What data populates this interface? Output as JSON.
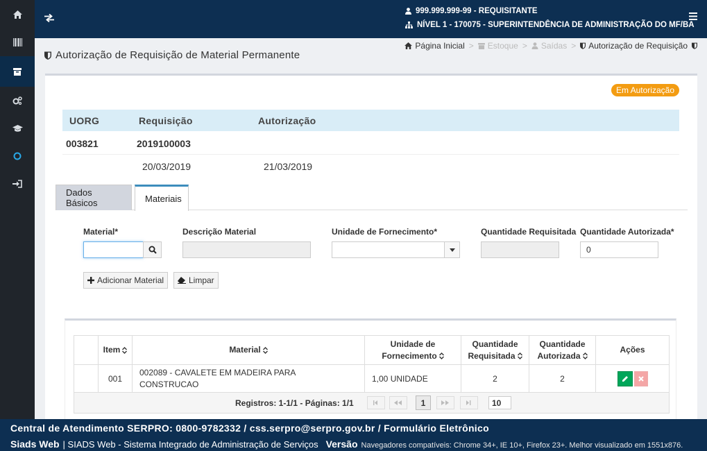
{
  "header": {
    "user": "999.999.999-99 - REQUISITANTE",
    "org": "NÍVEL 1 - 170075 - SUPERINTENDÊNCIA DE ADMINISTRAÇÃO DO MF/BA"
  },
  "page": {
    "title": "Autorização de Requisição de Material Permanente"
  },
  "breadcrumb": {
    "home": "Página Inicial",
    "stock": "Estoque",
    "outputs": "Saídas",
    "current": "Autorização de Requisição",
    "sep": ">"
  },
  "status": "Em Autorização",
  "info": {
    "headers": {
      "uorg": "UORG",
      "requisition": "Requisição",
      "authorization": "Autorização"
    },
    "uorg": "003821",
    "requisition": "2019100003",
    "requisition_date": "20/03/2019",
    "authorization_date": "21/03/2019"
  },
  "tabs": {
    "basic": "Dados Básicos",
    "materials": "Materiais"
  },
  "form": {
    "material_label": "Material*",
    "description_label": "Descrição Material",
    "unit_label": "Unidade de Fornecimento*",
    "qty_requested_label": "Quantidade Requisitada",
    "qty_authorized_label": "Quantidade Autorizada*",
    "qty_authorized_value": "0",
    "add_button": "Adicionar Material",
    "clear_button": "Limpar"
  },
  "table": {
    "headers": {
      "item": "Item",
      "material": "Material",
      "unit_l1": "Unidade de",
      "unit_l2": "Fornecimento",
      "req_l1": "Quantidade",
      "req_l2": "Requisitada",
      "auth_l1": "Quantidade",
      "auth_l2": "Autorizada",
      "actions": "Ações"
    },
    "rows": [
      {
        "item": "001",
        "material_l1": "002089 - CAVALETE EM MADEIRA PARA",
        "material_l2": "CONSTRUCAO",
        "unit": "1,00 UNIDADE",
        "requested": "2",
        "authorized": "2"
      }
    ]
  },
  "pager": {
    "text": "Registros: 1-1/1 - Páginas: 1/1",
    "current_page": "1",
    "page_size": "10"
  },
  "footer": {
    "line1": "Central de Atendimento SERPRO: 0800-9782332 / css.serpro@serpro.gov.br / Formulário Eletrônico",
    "brand": "Siads Web",
    "desc": "| SIADS Web - Sistema Integrado de Administração de Serviços",
    "version_label": "Versão",
    "browsers": "Navegadores compatíveis: Chrome 34+, IE 10+, Firefox 23+. Melhor visualizado em 1551x876."
  },
  "colors": {
    "header_bg": "#0d2f52",
    "sidebar_bg": "#20252b",
    "badge": "#f39c12",
    "edit": "#00a65a",
    "info_head": "#d9edf7"
  }
}
